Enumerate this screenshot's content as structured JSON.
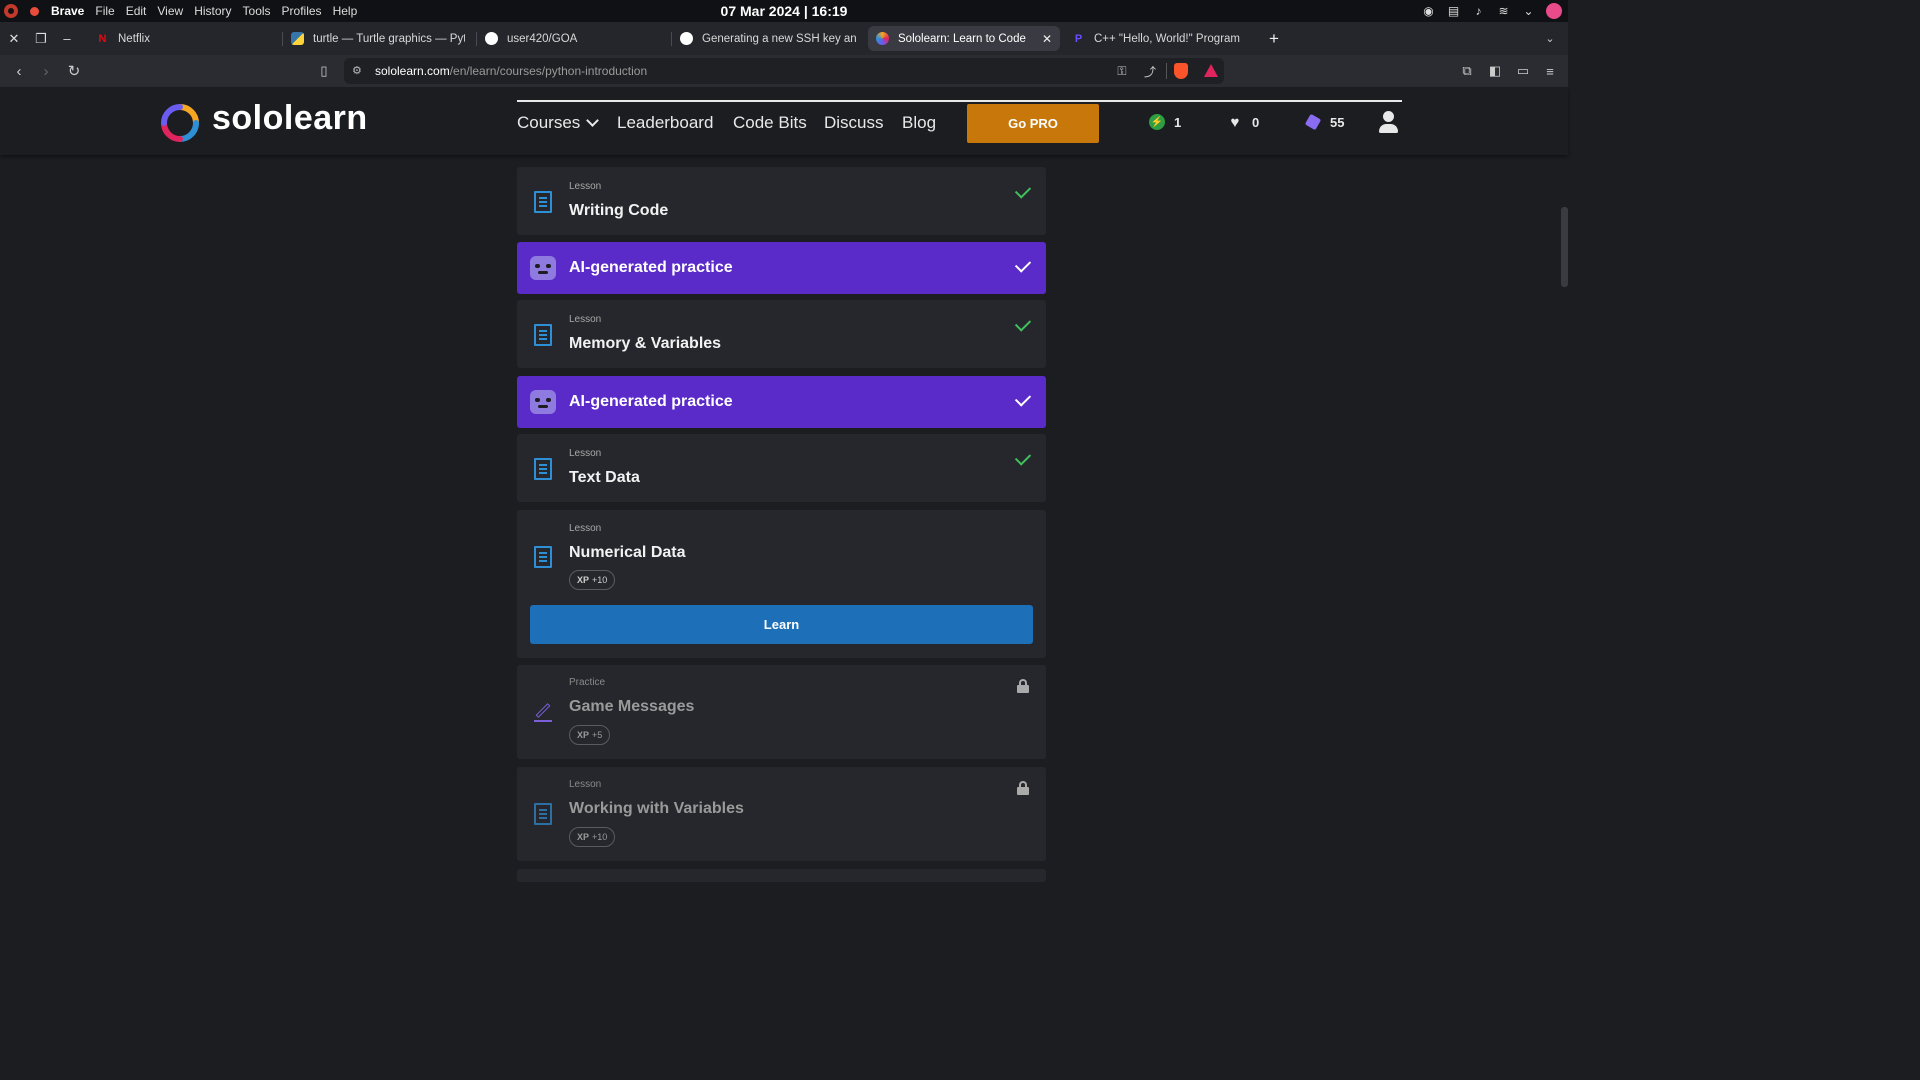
{
  "os": {
    "menu": [
      "Brave",
      "File",
      "Edit",
      "View",
      "History",
      "Tools",
      "Profiles",
      "Help"
    ],
    "clock": "07 Mar 2024 | 16:19"
  },
  "tabs": [
    {
      "label": "Netflix",
      "favicon": "netflix-icon",
      "fav_char": "N",
      "fav_color": "#e50914"
    },
    {
      "label": "turtle — Turtle graphics — Python",
      "favicon": "python-icon",
      "fav_char": "",
      "fav_color": "#3776ab"
    },
    {
      "label": "user420/GOA",
      "favicon": "github-icon",
      "fav_char": "",
      "fav_color": "#ffffff"
    },
    {
      "label": "Generating a new SSH key and ac",
      "favicon": "github-icon",
      "fav_char": "",
      "fav_color": "#ffffff"
    },
    {
      "label": "Sololearn: Learn to Code",
      "favicon": "sololearn-icon",
      "fav_char": "",
      "fav_color": "#6b5cf0",
      "active": true
    },
    {
      "label": "C++ \"Hello, World!\" Program",
      "favicon": "programiz-icon",
      "fav_char": "P",
      "fav_color": "#4a3cff"
    }
  ],
  "address": {
    "host": "sololearn.com",
    "path": "/en/learn/courses/python-introduction"
  },
  "site": {
    "logo_text": "sololearn",
    "nav": {
      "courses": "Courses",
      "leaderboard": "Leaderboard",
      "code_bits": "Code Bits",
      "discuss": "Discuss",
      "blog": "Blog"
    },
    "go_pro": "Go PRO",
    "stats": {
      "streak": "1",
      "hearts": "0",
      "gems": "55"
    }
  },
  "cards": [
    {
      "kind": "Lesson",
      "title": "Writing Code",
      "type": "lesson",
      "status": "done"
    },
    {
      "title": "AI-generated practice",
      "type": "ai",
      "status": "done"
    },
    {
      "kind": "Lesson",
      "title": "Memory & Variables",
      "type": "lesson",
      "status": "done"
    },
    {
      "title": "AI-generated practice",
      "type": "ai",
      "status": "done"
    },
    {
      "kind": "Lesson",
      "title": "Text Data",
      "type": "lesson",
      "status": "done"
    },
    {
      "kind": "Lesson",
      "title": "Numerical Data",
      "type": "lesson",
      "status": "current",
      "xp_label": "XP",
      "xp_value": "+10",
      "action": "Learn"
    },
    {
      "kind": "Practice",
      "title": "Game Messages",
      "type": "practice",
      "status": "locked",
      "xp_label": "XP",
      "xp_value": "+5"
    },
    {
      "kind": "Lesson",
      "title": "Working with Variables",
      "type": "lesson",
      "status": "locked",
      "xp_label": "XP",
      "xp_value": "+10"
    }
  ],
  "colors": {
    "ai_card": "#5b2bc9",
    "go_pro": "#c8780a",
    "learn_button": "#1d6fb8",
    "check_green": "#3fc25c",
    "card_bg": "#26272c",
    "page_bg": "#1c1d21"
  }
}
